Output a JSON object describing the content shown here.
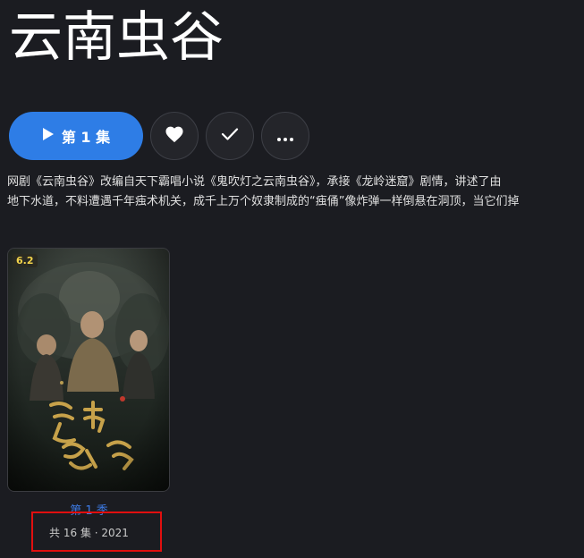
{
  "page": {
    "title": "云南虫谷"
  },
  "actions": {
    "play_label": "第 1 集",
    "play_icon": "play-icon",
    "favorite_icon": "heart-icon",
    "watched_icon": "check-icon",
    "more_icon": "more-icon"
  },
  "description": {
    "line1": "网剧《云南虫谷》改编自天下霸唱小说《鬼吹灯之云南虫谷》，承接《龙岭迷窟》剧情，讲述了由",
    "line2": "地下水道，不料遭遇千年痋术机关，成千上万个奴隶制成的“痋俑”像炸弹一样倒悬在洞顶，当它们掉"
  },
  "seasons": [
    {
      "rating": "6.2",
      "name": "第 1 季",
      "meta": "共 16 集 · 2021"
    }
  ],
  "colors": {
    "background": "#1b1c21",
    "accent": "#2e7de6",
    "link": "#3d7be6",
    "rating": "#f2d34b",
    "highlight": "#e10f0f"
  }
}
